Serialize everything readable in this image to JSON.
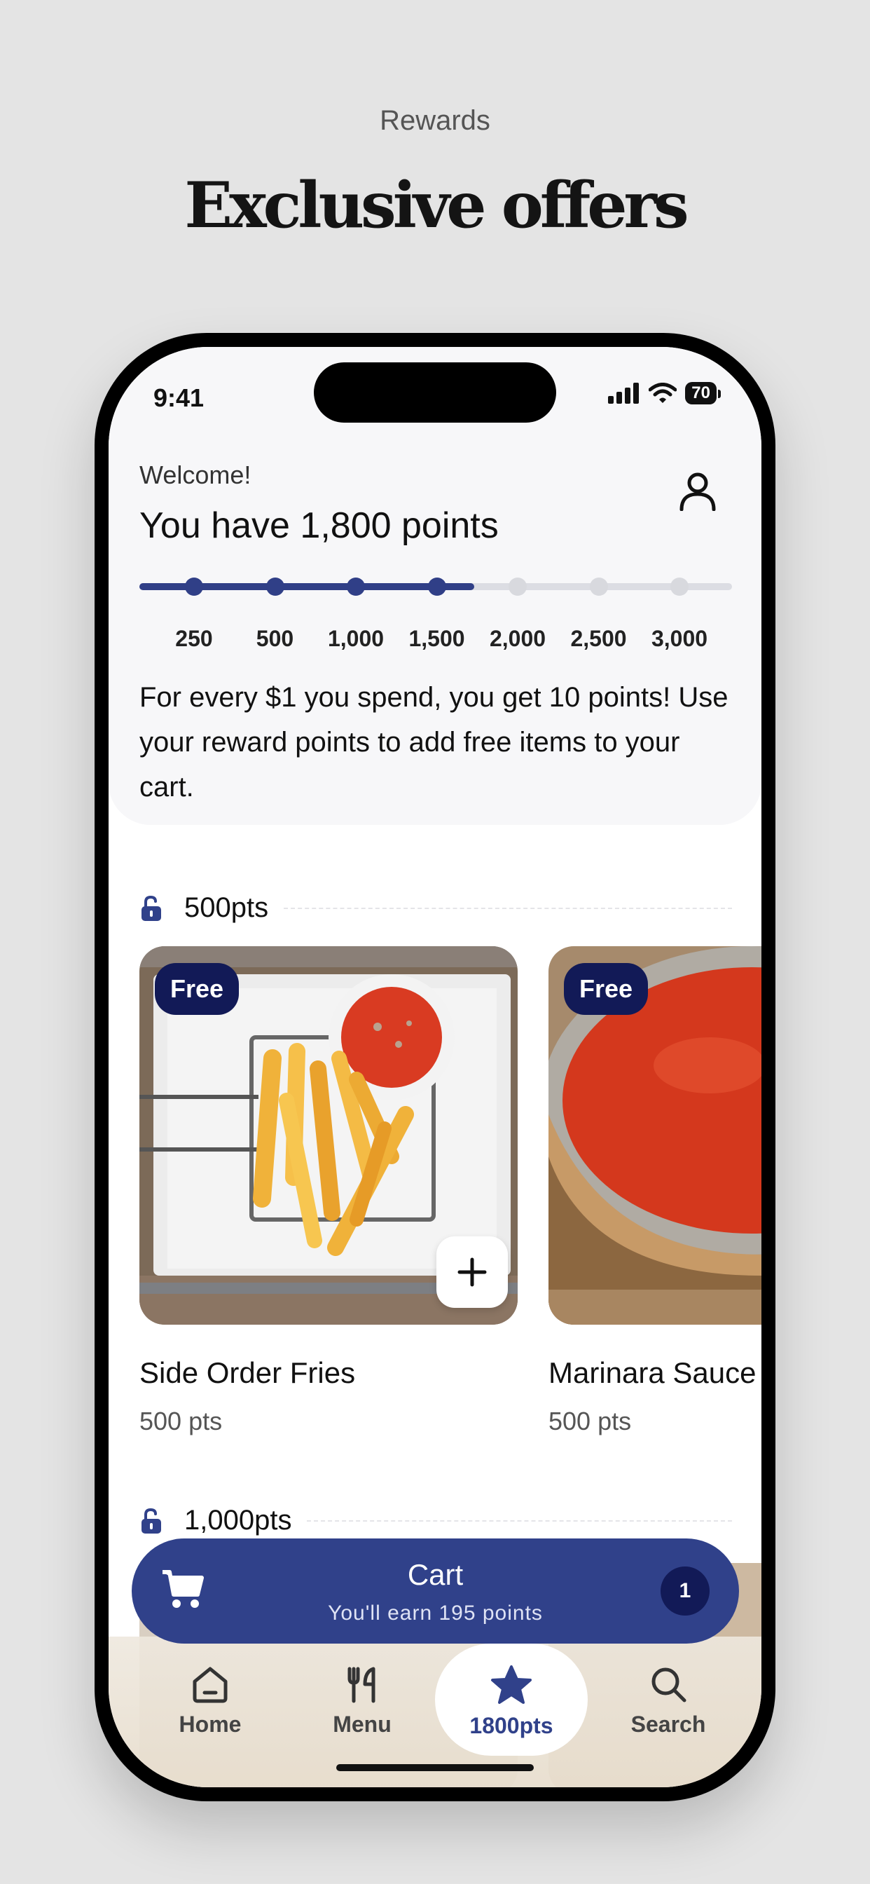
{
  "page": {
    "kicker": "Rewards",
    "headline": "Exclusive offers"
  },
  "status_bar": {
    "time": "9:41",
    "battery": "70"
  },
  "header": {
    "welcome": "Welcome!",
    "points_title": "You have 1,800 points",
    "progress_fraction": 0.565,
    "milestones": [
      {
        "label": "250",
        "reached": true
      },
      {
        "label": "500",
        "reached": true
      },
      {
        "label": "1,000",
        "reached": true
      },
      {
        "label": "1,500",
        "reached": true
      },
      {
        "label": "2,000",
        "reached": false
      },
      {
        "label": "2,500",
        "reached": false
      },
      {
        "label": "3,000",
        "reached": false
      }
    ],
    "description": "For every $1 you spend, you get 10 points! Use your reward points to add free items to your cart."
  },
  "tiers": [
    {
      "label": "500pts",
      "items": [
        {
          "badge": "Free",
          "name": "Side Order Fries",
          "points": "500 pts"
        },
        {
          "badge": "Free",
          "name": "Marinara Sauce",
          "points": "500 pts"
        }
      ]
    },
    {
      "label": "1,000pts"
    }
  ],
  "cart": {
    "title": "Cart",
    "subtitle": "You'll earn 195 points",
    "count": "1"
  },
  "tabbar": {
    "tabs": [
      {
        "label": "Home",
        "icon": "home-icon"
      },
      {
        "label": "Menu",
        "icon": "fork-knife-icon"
      },
      {
        "label": "1800pts",
        "icon": "star-icon",
        "active": true
      },
      {
        "label": "Search",
        "icon": "search-icon"
      }
    ]
  },
  "colors": {
    "accent": "#303f87",
    "badge": "#121a57",
    "background": "#e4e4e4"
  }
}
